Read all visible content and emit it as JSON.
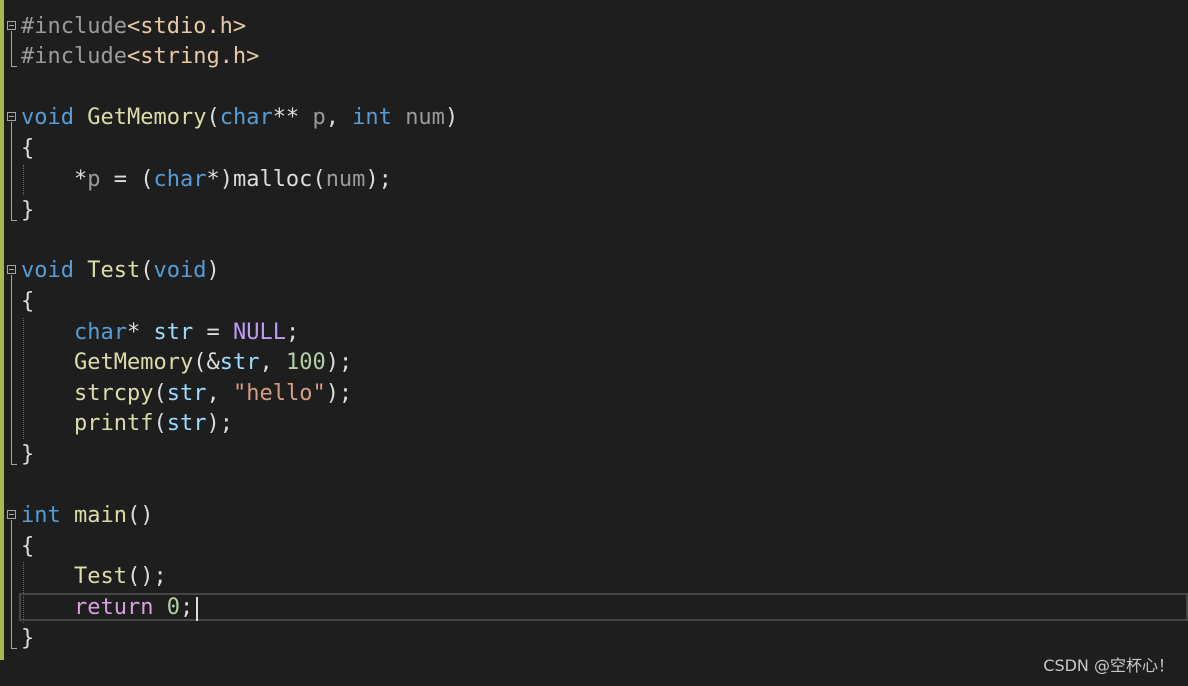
{
  "editor": {
    "lines": [
      [
        {
          "t": "#include",
          "k": "pp"
        },
        {
          "t": "<stdio.h>",
          "k": "inc"
        }
      ],
      [
        {
          "t": "#include",
          "k": "pp"
        },
        {
          "t": "<string.h>",
          "k": "inc"
        }
      ],
      [],
      [
        {
          "t": "void",
          "k": "kw"
        },
        {
          "t": " ",
          "k": "plain"
        },
        {
          "t": "GetMemory",
          "k": "fn"
        },
        {
          "t": "(",
          "k": "plain"
        },
        {
          "t": "char",
          "k": "kw"
        },
        {
          "t": "** ",
          "k": "plain"
        },
        {
          "t": "p",
          "k": "param"
        },
        {
          "t": ", ",
          "k": "plain"
        },
        {
          "t": "int",
          "k": "kw"
        },
        {
          "t": " ",
          "k": "plain"
        },
        {
          "t": "num",
          "k": "param"
        },
        {
          "t": ")",
          "k": "plain"
        }
      ],
      [
        {
          "t": "{",
          "k": "plain"
        }
      ],
      [
        {
          "t": "    *",
          "k": "plain"
        },
        {
          "t": "p",
          "k": "param"
        },
        {
          "t": " = (",
          "k": "plain"
        },
        {
          "t": "char",
          "k": "kw"
        },
        {
          "t": "*)",
          "k": "plain"
        },
        {
          "t": "malloc",
          "k": "plain"
        },
        {
          "t": "(",
          "k": "plain"
        },
        {
          "t": "num",
          "k": "param"
        },
        {
          "t": ");",
          "k": "plain"
        }
      ],
      [
        {
          "t": "}",
          "k": "plain"
        }
      ],
      [],
      [
        {
          "t": "void",
          "k": "kw"
        },
        {
          "t": " ",
          "k": "plain"
        },
        {
          "t": "Test",
          "k": "fn"
        },
        {
          "t": "(",
          "k": "plain"
        },
        {
          "t": "void",
          "k": "kw"
        },
        {
          "t": ")",
          "k": "plain"
        }
      ],
      [
        {
          "t": "{",
          "k": "plain"
        }
      ],
      [
        {
          "t": "    ",
          "k": "plain"
        },
        {
          "t": "char",
          "k": "kw"
        },
        {
          "t": "* ",
          "k": "plain"
        },
        {
          "t": "str",
          "k": "var"
        },
        {
          "t": " = ",
          "k": "plain"
        },
        {
          "t": "NULL",
          "k": "macro"
        },
        {
          "t": ";",
          "k": "plain"
        }
      ],
      [
        {
          "t": "    ",
          "k": "plain"
        },
        {
          "t": "GetMemory",
          "k": "fn"
        },
        {
          "t": "(&",
          "k": "plain"
        },
        {
          "t": "str",
          "k": "var"
        },
        {
          "t": ", ",
          "k": "plain"
        },
        {
          "t": "100",
          "k": "num"
        },
        {
          "t": ");",
          "k": "plain"
        }
      ],
      [
        {
          "t": "    ",
          "k": "plain"
        },
        {
          "t": "strcpy",
          "k": "fn"
        },
        {
          "t": "(",
          "k": "plain"
        },
        {
          "t": "str",
          "k": "var"
        },
        {
          "t": ", ",
          "k": "plain"
        },
        {
          "t": "\"hello\"",
          "k": "str"
        },
        {
          "t": ");",
          "k": "plain"
        }
      ],
      [
        {
          "t": "    ",
          "k": "plain"
        },
        {
          "t": "printf",
          "k": "fn"
        },
        {
          "t": "(",
          "k": "plain"
        },
        {
          "t": "str",
          "k": "var"
        },
        {
          "t": ");",
          "k": "plain"
        }
      ],
      [
        {
          "t": "}",
          "k": "plain"
        }
      ],
      [],
      [
        {
          "t": "int",
          "k": "kw"
        },
        {
          "t": " ",
          "k": "plain"
        },
        {
          "t": "main",
          "k": "fn"
        },
        {
          "t": "()",
          "k": "plain"
        }
      ],
      [
        {
          "t": "{",
          "k": "plain"
        }
      ],
      [
        {
          "t": "    ",
          "k": "plain"
        },
        {
          "t": "Test",
          "k": "fn"
        },
        {
          "t": "();",
          "k": "plain"
        }
      ],
      [
        {
          "t": "    ",
          "k": "plain"
        },
        {
          "t": "return",
          "k": "ctrl"
        },
        {
          "t": " ",
          "k": "plain"
        },
        {
          "t": "0",
          "k": "num"
        },
        {
          "t": ";",
          "k": "plain"
        }
      ],
      [
        {
          "t": "}",
          "k": "plain"
        }
      ]
    ],
    "current_line": 20,
    "colors": {
      "background": "#1e1e1e",
      "keyword": "#569cd6",
      "function": "#dcdcaa",
      "include": "#e8c9a5",
      "preprocessor": "#9b9b9b",
      "string": "#d69d85",
      "number": "#b5cea8",
      "macro": "#bd9cf5",
      "control": "#d8a0df",
      "variable": "#9cdcfe",
      "change_bar": "#a8b94a"
    }
  },
  "watermark": {
    "text": "CSDN @空杯心！"
  }
}
